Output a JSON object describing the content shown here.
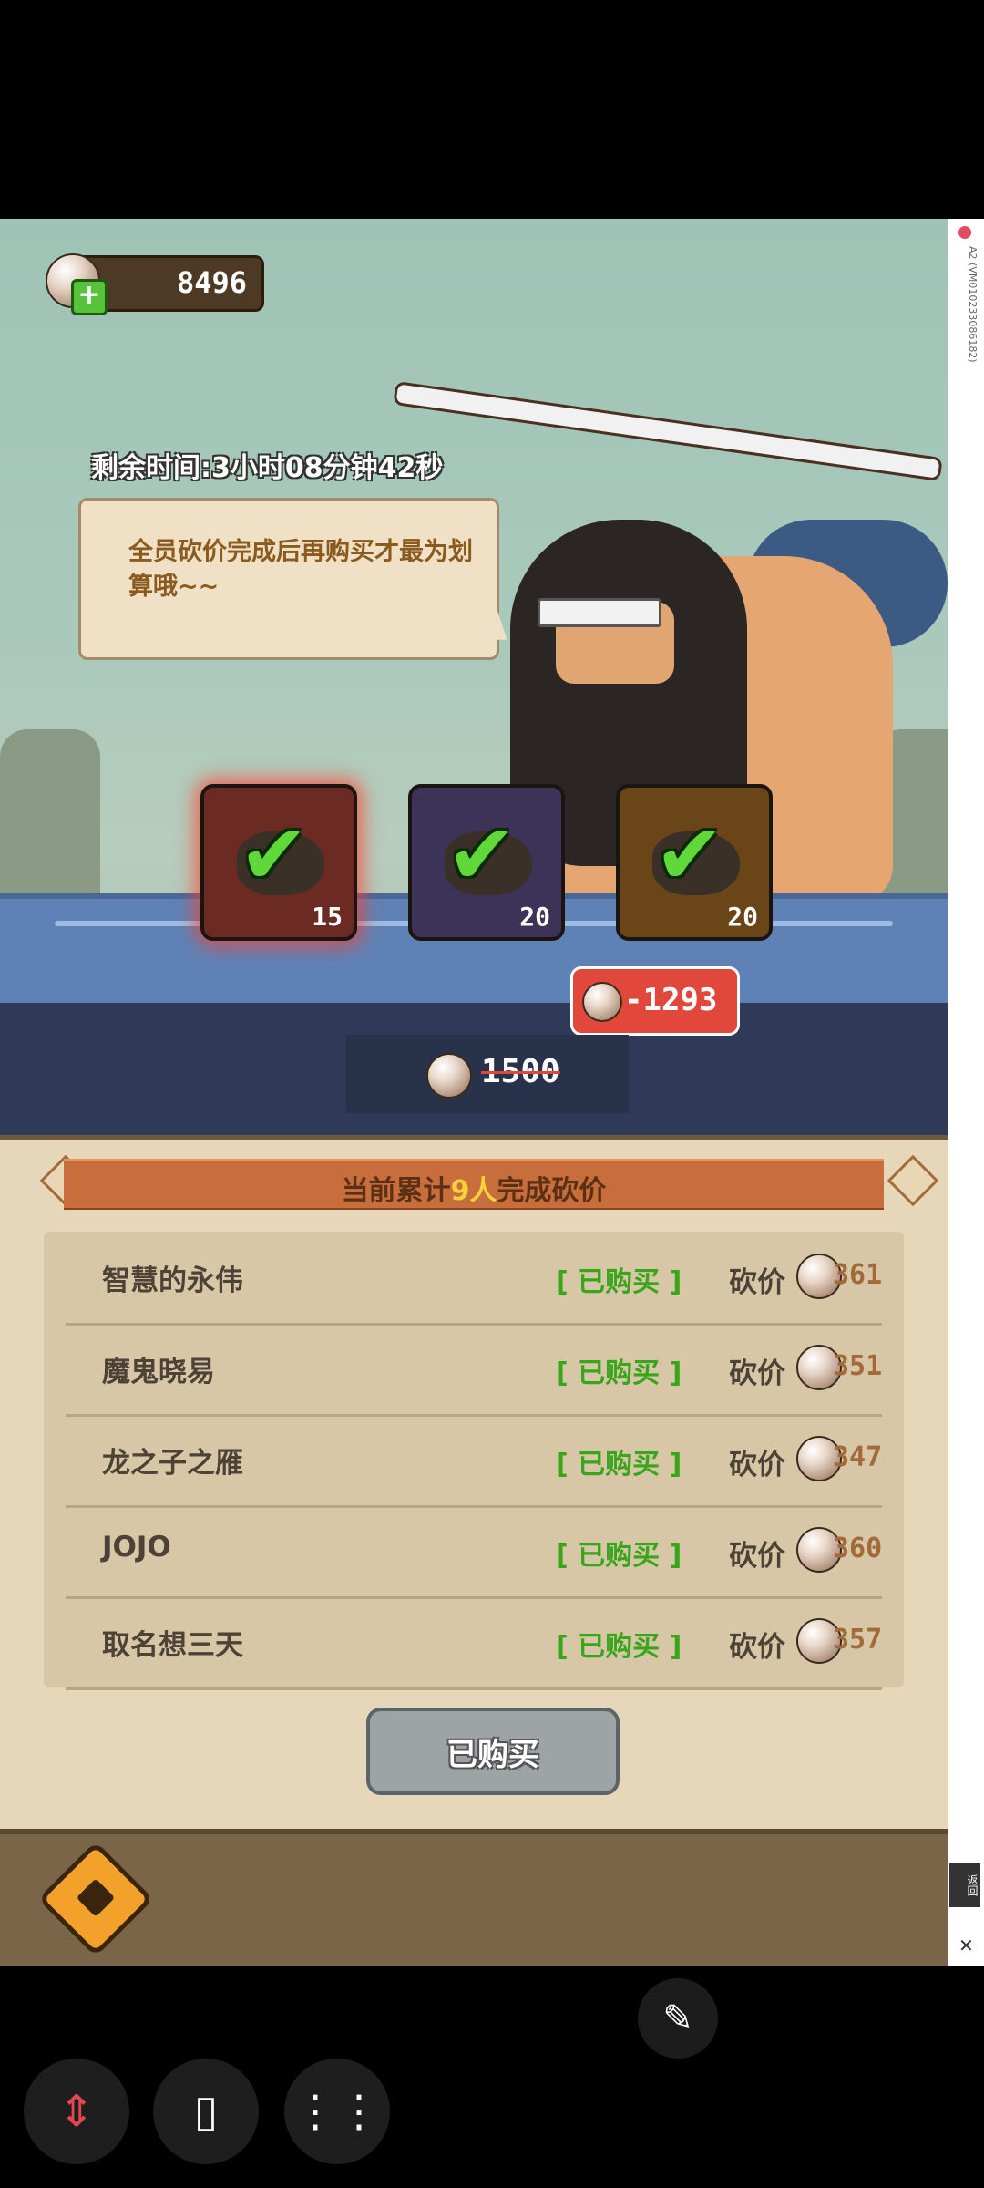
{
  "coins": {
    "value": "8496"
  },
  "timer": {
    "text": "剩余时间:3小时08分钟42秒"
  },
  "bubble": {
    "text": "全员砍价完成后再购买才最为划算哦~~"
  },
  "items": [
    {
      "count": "15",
      "state": "checked"
    },
    {
      "count": "20",
      "state": "checked"
    },
    {
      "count": "20",
      "state": "checked"
    }
  ],
  "price": {
    "new": "-1293",
    "old": "1500"
  },
  "banner": {
    "prefix": "当前累计",
    "count": "9人",
    "suffix": "完成砍价"
  },
  "list": [
    {
      "name": "智慧的永伟",
      "status": "[ 已购买 ]",
      "cut_label": "砍价",
      "cut": "361"
    },
    {
      "name": "魔鬼晓易",
      "status": "[ 已购买 ]",
      "cut_label": "砍价",
      "cut": "351"
    },
    {
      "name": "龙之子之雁",
      "status": "[ 已购买 ]",
      "cut_label": "砍价",
      "cut": "347"
    },
    {
      "name": "JOJO",
      "status": "[ 已购买 ]",
      "cut_label": "砍价",
      "cut": "360"
    },
    {
      "name": "取名想三天",
      "status": "[ 已购买 ]",
      "cut_label": "砍价",
      "cut": "357"
    }
  ],
  "buy_button": {
    "label": "已购买"
  },
  "side": {
    "label": "A2 (VM010233086182)",
    "button": "返回"
  },
  "icons": {
    "back": "back-arrow-icon",
    "edit": "pencil-icon",
    "nav": [
      "up-down-arrows-icon",
      "keyboard-icon",
      "menu-dots-icon"
    ]
  },
  "colors": {
    "accent": "#e2473b",
    "check": "#60d83a",
    "status": "#38a51a",
    "banner": "#c86e3c"
  }
}
